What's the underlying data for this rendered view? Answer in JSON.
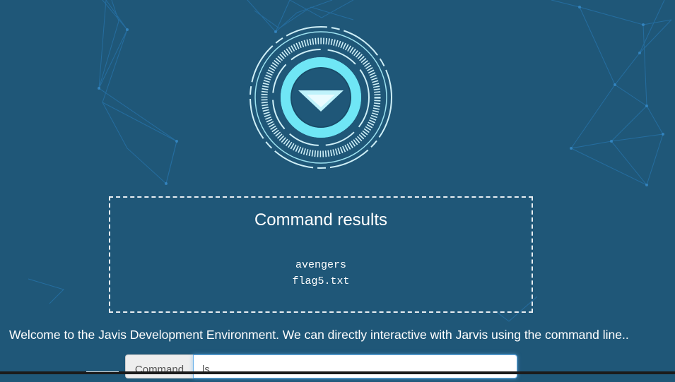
{
  "colors": {
    "background": "#1f5778",
    "network_lines": "#2a7fbf",
    "logo_cyan": "#6fe6f5",
    "logo_ring": "#cfeff7"
  },
  "logo": {
    "icon": "arc-reactor-triangle-icon"
  },
  "results": {
    "title": "Command results",
    "lines": [
      "avengers",
      "flag5.txt"
    ]
  },
  "welcome": "Welcome to the Javis Development Environment. We can directly interactive with Jarvis using the command line..",
  "command": {
    "label": "Command",
    "value": "ls .."
  }
}
